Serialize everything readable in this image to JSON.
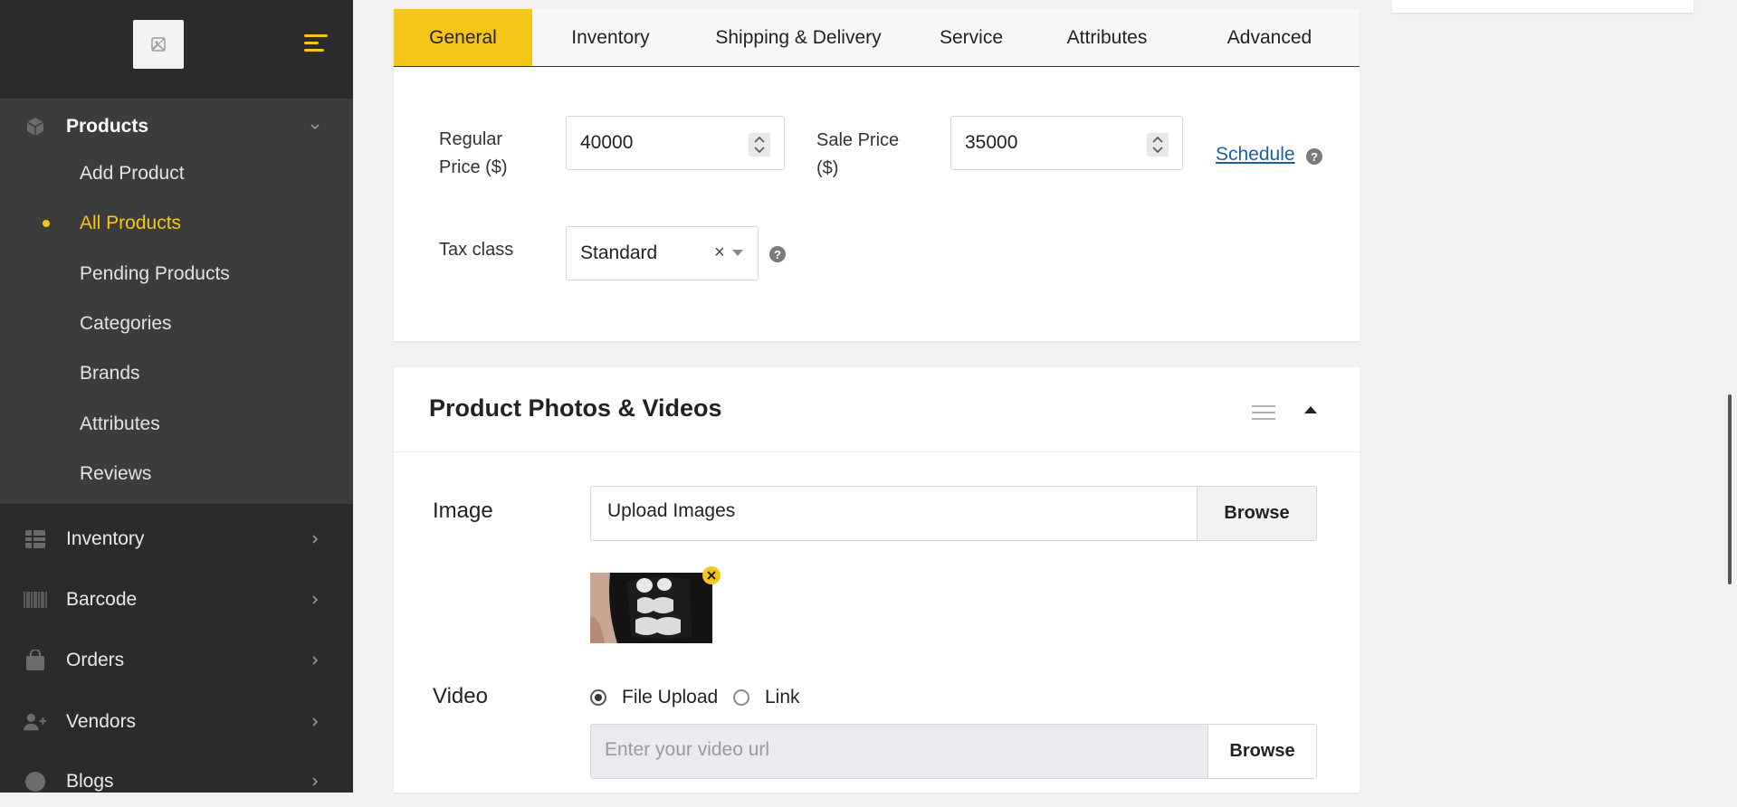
{
  "sidebar": {
    "products": {
      "label": "Products"
    },
    "sub_items": [
      {
        "label": "Add Product"
      },
      {
        "label": "All Products"
      },
      {
        "label": "Pending Products"
      },
      {
        "label": "Categories"
      },
      {
        "label": "Brands"
      },
      {
        "label": "Attributes"
      },
      {
        "label": "Reviews"
      }
    ],
    "items": [
      {
        "label": "Inventory"
      },
      {
        "label": "Barcode"
      },
      {
        "label": "Orders"
      },
      {
        "label": "Vendors"
      },
      {
        "label": "Blogs"
      }
    ],
    "active_item": "All Products",
    "accent": "#f5c518"
  },
  "tabs": [
    {
      "label": "General"
    },
    {
      "label": "Inventory"
    },
    {
      "label": "Shipping & Delivery"
    },
    {
      "label": "Service"
    },
    {
      "label": "Attributes"
    },
    {
      "label": "Advanced"
    }
  ],
  "general": {
    "regular_price_label": "Regular Price ($)",
    "regular_price_line1": "Regular",
    "regular_price_line2": "Price ($)",
    "regular_price_value": "40000",
    "sale_price_line1": "Sale Price",
    "sale_price_line2": "($)",
    "sale_price_value": "35000",
    "schedule_link": "Schedule",
    "tax_class_label": "Tax class",
    "tax_class_value": "Standard",
    "help_glyph": "?",
    "clear_glyph": "×"
  },
  "photos": {
    "title": "Product Photos & Videos",
    "image_label": "Image",
    "upload_placeholder": "Upload Images",
    "browse_label": "Browse",
    "video_label": "Video",
    "video_options": [
      {
        "label": "File Upload",
        "selected": true
      },
      {
        "label": "Link",
        "selected": false
      }
    ],
    "video_placeholder": "Enter your video url",
    "video_browse_label": "Browse"
  }
}
